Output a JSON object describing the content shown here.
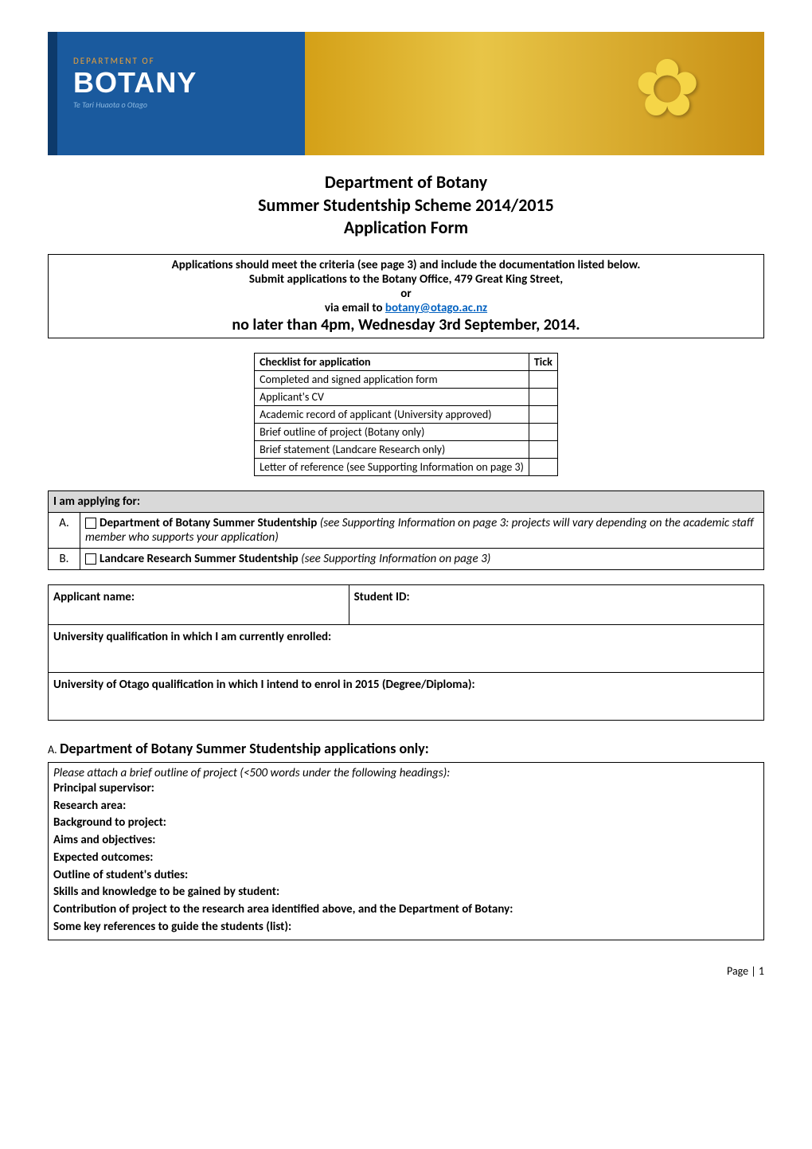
{
  "banner": {
    "dept_label": "DEPARTMENT OF",
    "name": "BOTANY",
    "subtitle": "Te Tari Huaota o Otago"
  },
  "title": {
    "line1": "Department of Botany",
    "line2": "Summer Studentship Scheme 2014/2015",
    "line3": "Application Form"
  },
  "instructions": {
    "line1": "Applications should meet the criteria (see page 3) and include the documentation listed below.",
    "line2": "Submit applications to the Botany Office, 479 Great King Street,",
    "or": "or",
    "email_prefix": "via email to ",
    "email": "botany@otago.ac.nz",
    "deadline": "no later than 4pm, Wednesday 3rd September, 2014."
  },
  "checklist": {
    "header": "Checklist for application",
    "tick_header": "Tick",
    "items": [
      "Completed and signed application form",
      "Applicant's CV",
      "Academic record of applicant (University approved)",
      "Brief outline of project (Botany only)",
      "Brief statement (Landcare Research only)",
      "Letter of reference (see Supporting Information on page 3)"
    ]
  },
  "applying": {
    "header": "I am applying for:",
    "options": [
      {
        "letter": "A.",
        "bold": "Department of Botany Summer Studentship",
        "italic": "  (see Supporting Information on page 3:  projects will vary depending on the academic staff member who supports your application)"
      },
      {
        "letter": "B.",
        "bold": "Landcare Research Summer Studentship",
        "italic": "  (see Supporting Information on page 3)"
      }
    ]
  },
  "info": {
    "name_label": "Applicant name:",
    "id_label": "Student ID:",
    "current_qual_label": "University qualification in which I am currently enrolled:",
    "intend_qual_label": "University of Otago qualification in which I intend to enrol in 2015 (Degree/Diploma):"
  },
  "section_a": {
    "letter": "A.",
    "heading": "Department of Botany Summer Studentship applications only:",
    "intro": "Please attach a brief outline of project (<500 words under the following headings):",
    "fields": [
      "Principal supervisor:",
      "Research area:",
      "Background to project:",
      "Aims and objectives:",
      "Expected outcomes:",
      "Outline of student's duties:",
      "Skills and knowledge to be gained by student:",
      "Contribution of project to the research area identified above, and the Department of Botany:",
      "Some key references to guide the students (list):"
    ]
  },
  "footer": {
    "page": "Page | 1"
  }
}
